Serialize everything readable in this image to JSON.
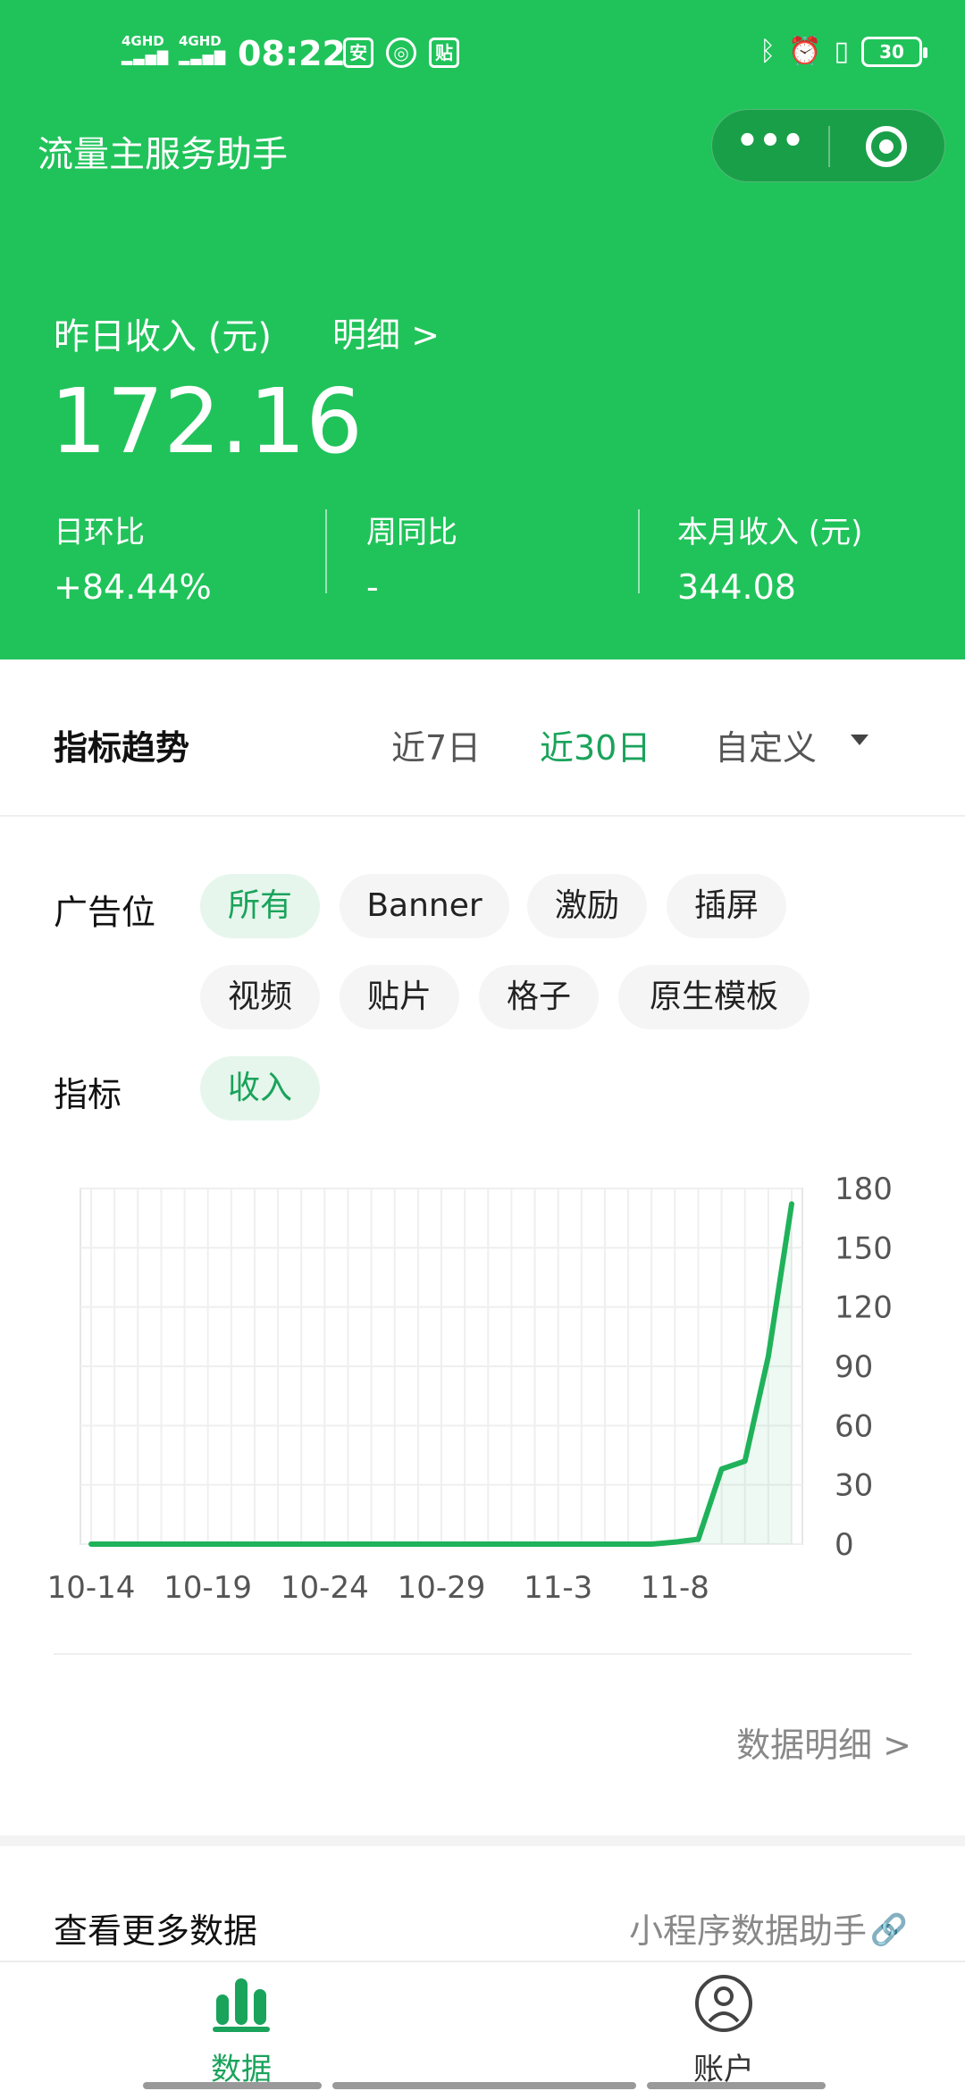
{
  "status_bar": {
    "network1": "4GHD",
    "network2": "4GHD",
    "time": "08:22",
    "icon_labels": [
      "安",
      "贴"
    ],
    "battery": "30"
  },
  "header": {
    "app_title": "流量主服务助手"
  },
  "summary": {
    "label": "昨日收入 (元)",
    "detail_link": "明细 >",
    "value": "172.16",
    "stats": [
      {
        "label": "日环比",
        "value": "+84.44%"
      },
      {
        "label": "周同比",
        "value": "-"
      },
      {
        "label": "本月收入 (元)",
        "value": "344.08"
      }
    ]
  },
  "trend": {
    "title": "指标趋势",
    "ranges": [
      "近7日",
      "近30日",
      "自定义"
    ],
    "active_range": "近30日",
    "ad_slot_label": "广告位",
    "ad_slots": [
      "所有",
      "Banner",
      "激励",
      "插屏",
      "视频",
      "贴片",
      "格子",
      "原生模板"
    ],
    "active_slot": "所有",
    "metric_label": "指标",
    "metrics": [
      "收入"
    ],
    "active_metric": "收入",
    "data_detail": "数据明细 >"
  },
  "chart_data": {
    "type": "line",
    "x_tick_labels": [
      "10-14",
      "10-19",
      "10-24",
      "10-29",
      "11-3",
      "11-8"
    ],
    "y_tick_labels": [
      "0",
      "30",
      "60",
      "90",
      "120",
      "150",
      "180"
    ],
    "ylim": [
      0,
      180
    ],
    "x": [
      "10-14",
      "10-15",
      "10-16",
      "10-17",
      "10-18",
      "10-19",
      "10-20",
      "10-21",
      "10-22",
      "10-23",
      "10-24",
      "10-25",
      "10-26",
      "10-27",
      "10-28",
      "10-29",
      "10-30",
      "10-31",
      "11-1",
      "11-2",
      "11-3",
      "11-4",
      "11-5",
      "11-6",
      "11-7",
      "11-8",
      "11-9",
      "11-10",
      "11-11",
      "11-12"
    ],
    "values": [
      0,
      0,
      0,
      0,
      0,
      0,
      0,
      0,
      0,
      0,
      0,
      0,
      0,
      0,
      0,
      0,
      0,
      0,
      0,
      0,
      0,
      0,
      0,
      0,
      0,
      1,
      2.5,
      38,
      42,
      95,
      172.16
    ],
    "grid": true,
    "line_color": "#1fb25a"
  },
  "more": {
    "title": "查看更多数据",
    "right_label": "小程序数据助手",
    "link_icon": "🔗"
  },
  "tabbar": {
    "tabs": [
      {
        "label": "数据",
        "icon": "bar-chart-icon",
        "active": true
      },
      {
        "label": "账户",
        "icon": "user-icon",
        "active": false
      }
    ]
  },
  "colors": {
    "brand_green": "#20c35a",
    "accent_green": "#1aa35b"
  }
}
